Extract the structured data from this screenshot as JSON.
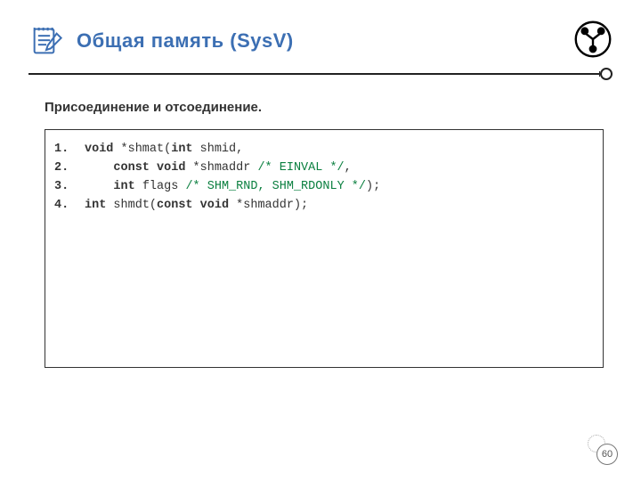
{
  "header": {
    "title": "Общая память (SysV)"
  },
  "subtitle": "Присоединение и отсоединение.",
  "code": {
    "lines": [
      {
        "n": "1.",
        "tokens": [
          {
            "t": "void",
            "c": "kw"
          },
          {
            "t": " *shmat("
          },
          {
            "t": "int",
            "c": "kw"
          },
          {
            "t": " shmid,"
          }
        ]
      },
      {
        "n": "2.",
        "tokens": [
          {
            "t": "    "
          },
          {
            "t": "const void",
            "c": "kw"
          },
          {
            "t": " *shmaddr "
          },
          {
            "t": "/* EINVAL */",
            "c": "cm"
          },
          {
            "t": ","
          }
        ]
      },
      {
        "n": "3.",
        "tokens": [
          {
            "t": "    "
          },
          {
            "t": "int",
            "c": "kw"
          },
          {
            "t": " flags "
          },
          {
            "t": "/* SHM_RND, SHM_RDONLY */",
            "c": "cm"
          },
          {
            "t": ");"
          }
        ]
      },
      {
        "n": "4.",
        "tokens": [
          {
            "t": "int",
            "c": "kw"
          },
          {
            "t": " shmdt("
          },
          {
            "t": "const void",
            "c": "kw"
          },
          {
            "t": " *shmaddr);"
          }
        ]
      }
    ]
  },
  "page_number": "60"
}
